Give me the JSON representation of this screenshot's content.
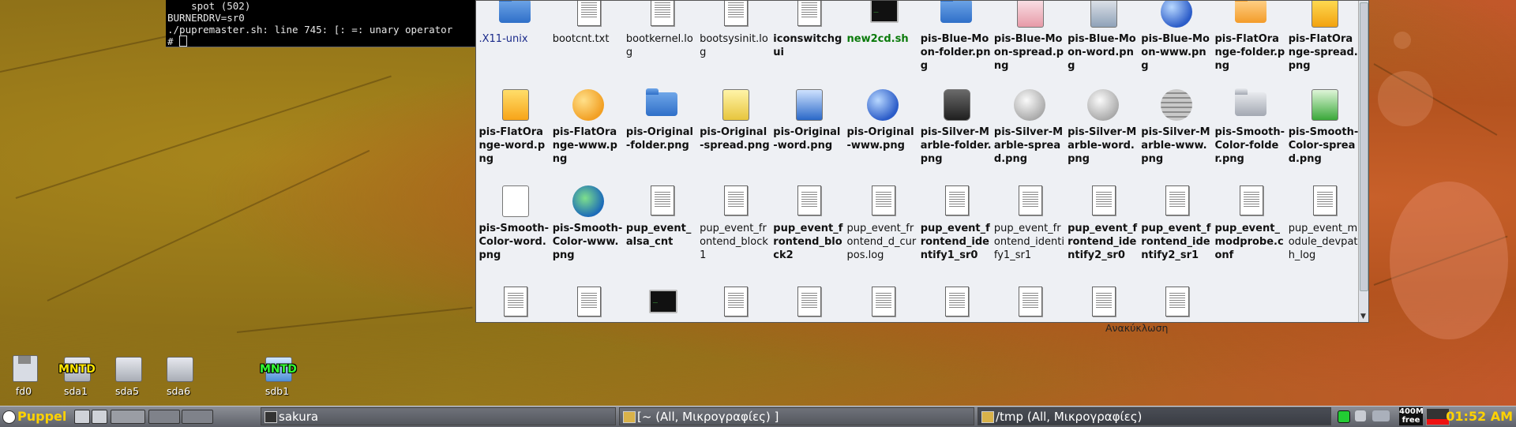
{
  "terminal": {
    "lines": [
      "    spot (502)",
      "BURNERDRV=sr0",
      "./pupremaster.sh: line 745: [: =: unary operator",
      "# "
    ]
  },
  "file_manager": {
    "items": [
      {
        "label": ".X11-unix",
        "icon": "folder-blue",
        "style": "blue"
      },
      {
        "label": "bootcnt.txt",
        "icon": "text-file",
        "style": ""
      },
      {
        "label": "bootkernel.log",
        "icon": "text-file",
        "style": ""
      },
      {
        "label": "bootsysinit.log",
        "icon": "text-file",
        "style": ""
      },
      {
        "label": "iconswitchgui",
        "icon": "text-file",
        "style": "bold"
      },
      {
        "label": "new2cd.sh",
        "icon": "terminal",
        "style": "green"
      },
      {
        "label": "pis-Blue-Moon-folder.png",
        "icon": "folder-blue",
        "style": "bold"
      },
      {
        "label": "pis-Blue-Moon-spread.png",
        "icon": "spreadsheet-pink",
        "style": "bold"
      },
      {
        "label": "pis-Blue-Moon-word.png",
        "icon": "word-grey",
        "style": "bold"
      },
      {
        "label": "pis-Blue-Moon-www.png",
        "icon": "globe-blue",
        "style": "bold"
      },
      {
        "label": "pis-FlatOrange-folder.png",
        "icon": "folder-orange",
        "style": "bold"
      },
      {
        "label": "pis-FlatOrange-spread.png",
        "icon": "spreadsheet-orange",
        "style": "bold"
      },
      {
        "label": "pis-FlatOrange-word.png",
        "icon": "word-orange",
        "style": "bold"
      },
      {
        "label": "pis-FlatOrange-www.png",
        "icon": "globe-orange",
        "style": "bold"
      },
      {
        "label": "pis-Original-folder.png",
        "icon": "folder-blue",
        "style": "bold"
      },
      {
        "label": "pis-Original-spread.png",
        "icon": "spreadsheet-yellow",
        "style": "bold"
      },
      {
        "label": "pis-Original-word.png",
        "icon": "word-pen",
        "style": "bold"
      },
      {
        "label": "pis-Original-www.png",
        "icon": "globe-blue",
        "style": "bold"
      },
      {
        "label": "pis-Silver-Marble-folder.png",
        "icon": "marble-dark",
        "style": "bold"
      },
      {
        "label": "pis-Silver-Marble-spread.png",
        "icon": "marble-light",
        "style": "bold"
      },
      {
        "label": "pis-Silver-Marble-word.png",
        "icon": "marble-light",
        "style": "bold"
      },
      {
        "label": "pis-Silver-Marble-www.png",
        "icon": "marble-sphere",
        "style": "bold"
      },
      {
        "label": "pis-Smooth-Color-folder.png",
        "icon": "folder-grey",
        "style": "bold"
      },
      {
        "label": "pis-Smooth-Color-spread.png",
        "icon": "spreadsheet-green",
        "style": "bold"
      },
      {
        "label": "pis-Smooth-Color-word.png",
        "icon": "document-white",
        "style": "bold"
      },
      {
        "label": "pis-Smooth-Color-www.png",
        "icon": "globe-earth",
        "style": "bold"
      },
      {
        "label": "pup_event_alsa_cnt",
        "icon": "text-file",
        "style": "bold"
      },
      {
        "label": "pup_event_frontend_block1",
        "icon": "text-file",
        "style": ""
      },
      {
        "label": "pup_event_frontend_block2",
        "icon": "text-file",
        "style": "bold"
      },
      {
        "label": "pup_event_frontend_d_curpos.log",
        "icon": "text-file",
        "style": ""
      },
      {
        "label": "pup_event_frontend_identify1_sr0",
        "icon": "text-file",
        "style": "bold"
      },
      {
        "label": "pup_event_frontend_identify1_sr1",
        "icon": "text-file",
        "style": ""
      },
      {
        "label": "pup_event_frontend_identify2_sr0",
        "icon": "text-file",
        "style": "bold"
      },
      {
        "label": "pup_event_frontend_identify2_sr1",
        "icon": "text-file",
        "style": "bold"
      },
      {
        "label": "pup_event_modprobe.conf",
        "icon": "text-file",
        "style": "bold"
      },
      {
        "label": "pup_event_module_devpath_log",
        "icon": "text-file",
        "style": ""
      },
      {
        "label": "",
        "icon": "text-file",
        "style": ""
      },
      {
        "label": "",
        "icon": "text-file",
        "style": ""
      },
      {
        "label": "",
        "icon": "terminal",
        "style": ""
      },
      {
        "label": "",
        "icon": "text-file",
        "style": ""
      },
      {
        "label": "",
        "icon": "text-file",
        "style": ""
      },
      {
        "label": "",
        "icon": "text-file",
        "style": ""
      },
      {
        "label": "",
        "icon": "text-file",
        "style": ""
      },
      {
        "label": "",
        "icon": "text-file",
        "style": ""
      },
      {
        "label": "",
        "icon": "text-file",
        "style": ""
      },
      {
        "label": "",
        "icon": "text-file",
        "style": ""
      }
    ]
  },
  "desktop": {
    "trash_label": "Ανακύκλωση",
    "drives": [
      {
        "label": "fd0",
        "icon": "floppy",
        "badge": ""
      },
      {
        "label": "sda1",
        "icon": "hdd",
        "badge": "MNTD"
      },
      {
        "label": "sda5",
        "icon": "hdd",
        "badge": ""
      },
      {
        "label": "sda6",
        "icon": "hdd",
        "badge": ""
      },
      {
        "label": "sdb1",
        "icon": "usb",
        "badge": "MNTD"
      }
    ]
  },
  "taskbar": {
    "menu_label": "Puppel",
    "tasks": [
      {
        "label": "sakura"
      },
      {
        "label": "[~ (All, Μικρογραφίες) ]"
      },
      {
        "label": "/tmp (All, Μικρογραφίες)"
      }
    ],
    "memory": "400M\nfree",
    "clock": "01:52 AM"
  },
  "colors": {
    "accent_yellow": "#ffd200",
    "task_bg": "#5d6068"
  }
}
